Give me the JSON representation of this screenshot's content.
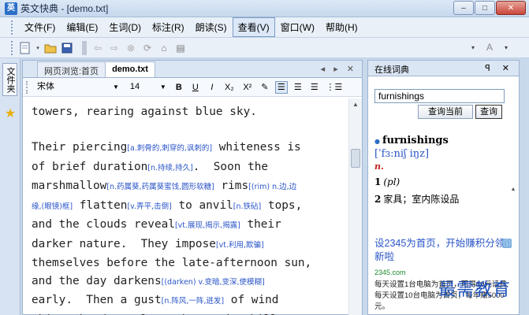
{
  "window": {
    "title": "英文快典 - [demo.txt]",
    "controls": {
      "minimize": "–",
      "maximize": "□",
      "close": "✕"
    }
  },
  "menu": [
    "文件(F)",
    "编辑(E)",
    "生词(D)",
    "标注(R)",
    "朗读(S)",
    "查看(V)",
    "窗口(W)",
    "帮助(H)"
  ],
  "active_menu_index": 5,
  "sidebar": {
    "vertical_tab_label": "文件夹"
  },
  "document": {
    "tabs": [
      {
        "label": "网页浏览:首页"
      },
      {
        "label": "demo.txt"
      }
    ],
    "active_tab_index": 1,
    "tab_controls": "◂ ▸ ✕",
    "font_name": "宋体",
    "font_size": "14",
    "format_buttons": {
      "bold": "B",
      "underline": "U",
      "italic": "I",
      "subscript": "X₂",
      "superscript": "X²"
    },
    "lines": [
      {
        "segments": [
          {
            "t": "towers, rearing against blue sky."
          }
        ]
      },
      {
        "segments": []
      },
      {
        "segments": [
          {
            "t": "Their piercing"
          },
          {
            "g": "[a.刺骨的,刺穿的,讽刺的]"
          },
          {
            "t": " whiteness is"
          }
        ]
      },
      {
        "segments": [
          {
            "t": "of brief duration"
          },
          {
            "g": "[n.持续,持久]"
          },
          {
            "t": ".  Soon the"
          }
        ]
      },
      {
        "segments": [
          {
            "t": "marshmallow"
          },
          {
            "g": "[n.药属葵,药属葵蜜饯,圆形软糖]"
          },
          {
            "t": " rims"
          },
          {
            "g": "[(rim) n.边,边"
          }
        ]
      },
      {
        "segments": [
          {
            "g": "缘,(眼镜)框]"
          },
          {
            "t": " flatten"
          },
          {
            "g": "[v.弄平,击倒]"
          },
          {
            "t": " to anvil"
          },
          {
            "g": "[n.铁砧]"
          },
          {
            "t": " tops,"
          }
        ]
      },
      {
        "segments": [
          {
            "t": "and the clouds reveal"
          },
          {
            "g": "[vt.展现,揭示,揭露]"
          },
          {
            "t": " their"
          }
        ]
      },
      {
        "segments": [
          {
            "t": "darker nature.  They impose"
          },
          {
            "g": "[vt.利用,欺骗]"
          }
        ]
      },
      {
        "segments": [
          {
            "t": "themselves before the late-afternoon sun,"
          }
        ]
      },
      {
        "segments": [
          {
            "t": "and the day darkens"
          },
          {
            "g": "[(darken) v.变暗,变深,使模糊]"
          }
        ]
      },
      {
        "segments": [
          {
            "t": "early.  Then a gust"
          },
          {
            "g": "[n.阵风,一阵,迸发]"
          },
          {
            "t": " of wind"
          }
        ]
      },
      {
        "segments": [
          {
            "t": "whips the dust along the road, chill"
          },
          {
            "g": "[vt.使变冷"
          }
        ]
      }
    ]
  },
  "dictionary": {
    "panel_title": "在线词典",
    "panel_controls": "ꟼ ✕",
    "search_value": "furnishings",
    "btn_query_current": "查询当前",
    "btn_query": "查询",
    "word": "furnishings",
    "phonetic": "[ˈfɜ:niʃ iŋz]",
    "pos": "n.",
    "senses": [
      {
        "num": "1",
        "text": "(pl)"
      },
      {
        "num": "2",
        "text": "家具；室内陈设品"
      }
    ],
    "ad": {
      "headline": "设2345为首页，开始赚积分领新啦",
      "domain": "2345.com",
      "body": "每天设置1台电脑为首页，可得60元话费 每天设置10台电脑为首页，每年赚5000元。"
    }
  },
  "watermark": "最需教育"
}
